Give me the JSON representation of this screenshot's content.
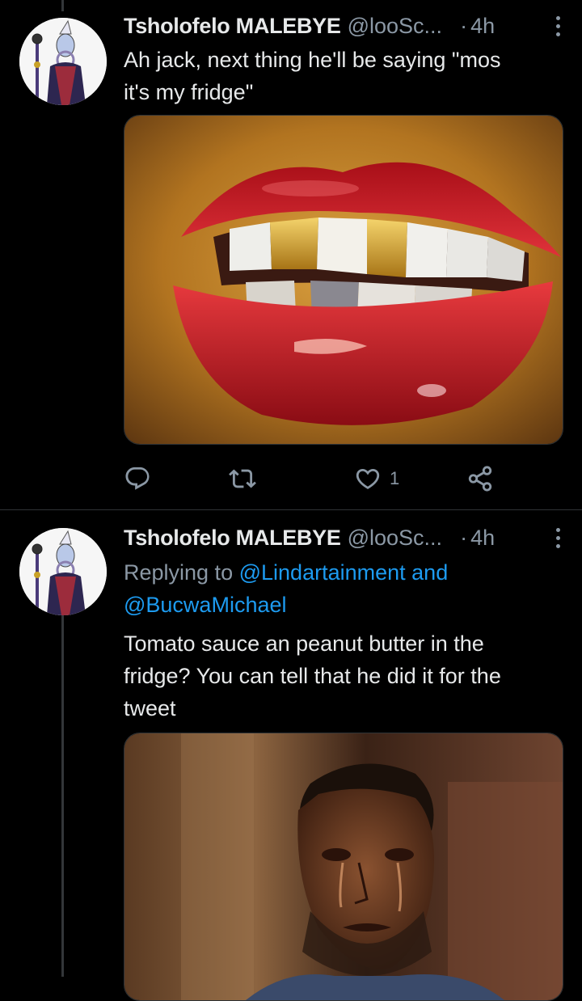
{
  "tweets": [
    {
      "author_name": "Tsholofelo MALEBYE",
      "author_handle": "@looSc...",
      "dot": "·",
      "time": "4h",
      "text_line1": "Ah jack, next thing he'll be saying \"mos",
      "text_line2": "it's my fridge\"",
      "media_icon": "image-lips-gold-teeth",
      "actions": {
        "reply_icon": "reply-icon",
        "retweet_icon": "retweet-icon",
        "like_icon": "heart-icon",
        "like_count": "1",
        "share_icon": "share-icon"
      }
    },
    {
      "author_name": "Tsholofelo MALEBYE",
      "author_handle": "@looSc...",
      "dot": "·",
      "time": "4h",
      "replying_prefix": "Replying to",
      "replying_mention_1": "@Lindartainment",
      "replying_and": "and",
      "replying_mention_2": "@BucwaMichael",
      "text_line1": "Tomato sauce an peanut butter in the",
      "text_line2": "fridge? You can tell that he did it for the",
      "text_line3": "tweet",
      "media_icon": "image-crying-man"
    }
  ],
  "colors": {
    "background": "#000000",
    "text": "#e7e9ea",
    "secondary": "#8b98a5",
    "link": "#1d9bf0"
  }
}
